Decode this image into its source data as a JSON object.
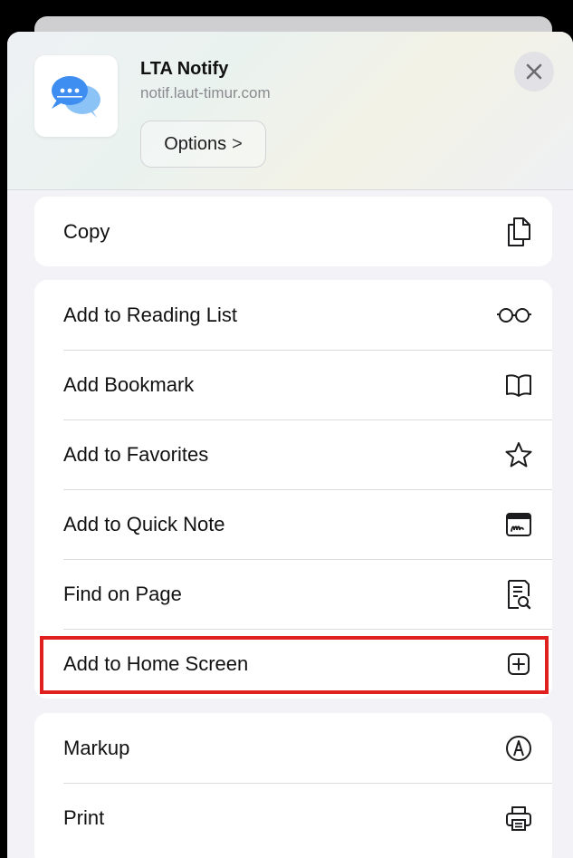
{
  "app": {
    "title": "LTA Notify",
    "url": "notif.laut-timur.com",
    "options_label": "Options",
    "options_chevron": ">",
    "icon": "chat-bubbles-icon"
  },
  "groups": [
    {
      "items": [
        {
          "label": "Copy",
          "icon": "copy-icon"
        }
      ]
    },
    {
      "items": [
        {
          "label": "Add to Reading List",
          "icon": "glasses-icon"
        },
        {
          "label": "Add Bookmark",
          "icon": "book-icon"
        },
        {
          "label": "Add to Favorites",
          "icon": "star-icon"
        },
        {
          "label": "Add to Quick Note",
          "icon": "quick-note-icon"
        },
        {
          "label": "Find on Page",
          "icon": "find-on-page-icon"
        },
        {
          "label": "Add to Home Screen",
          "icon": "add-square-icon"
        }
      ]
    },
    {
      "items": [
        {
          "label": "Markup",
          "icon": "markup-icon"
        },
        {
          "label": "Print",
          "icon": "printer-icon"
        }
      ]
    }
  ],
  "highlight_color": "#e0201f",
  "accent": "#3d8ef0"
}
